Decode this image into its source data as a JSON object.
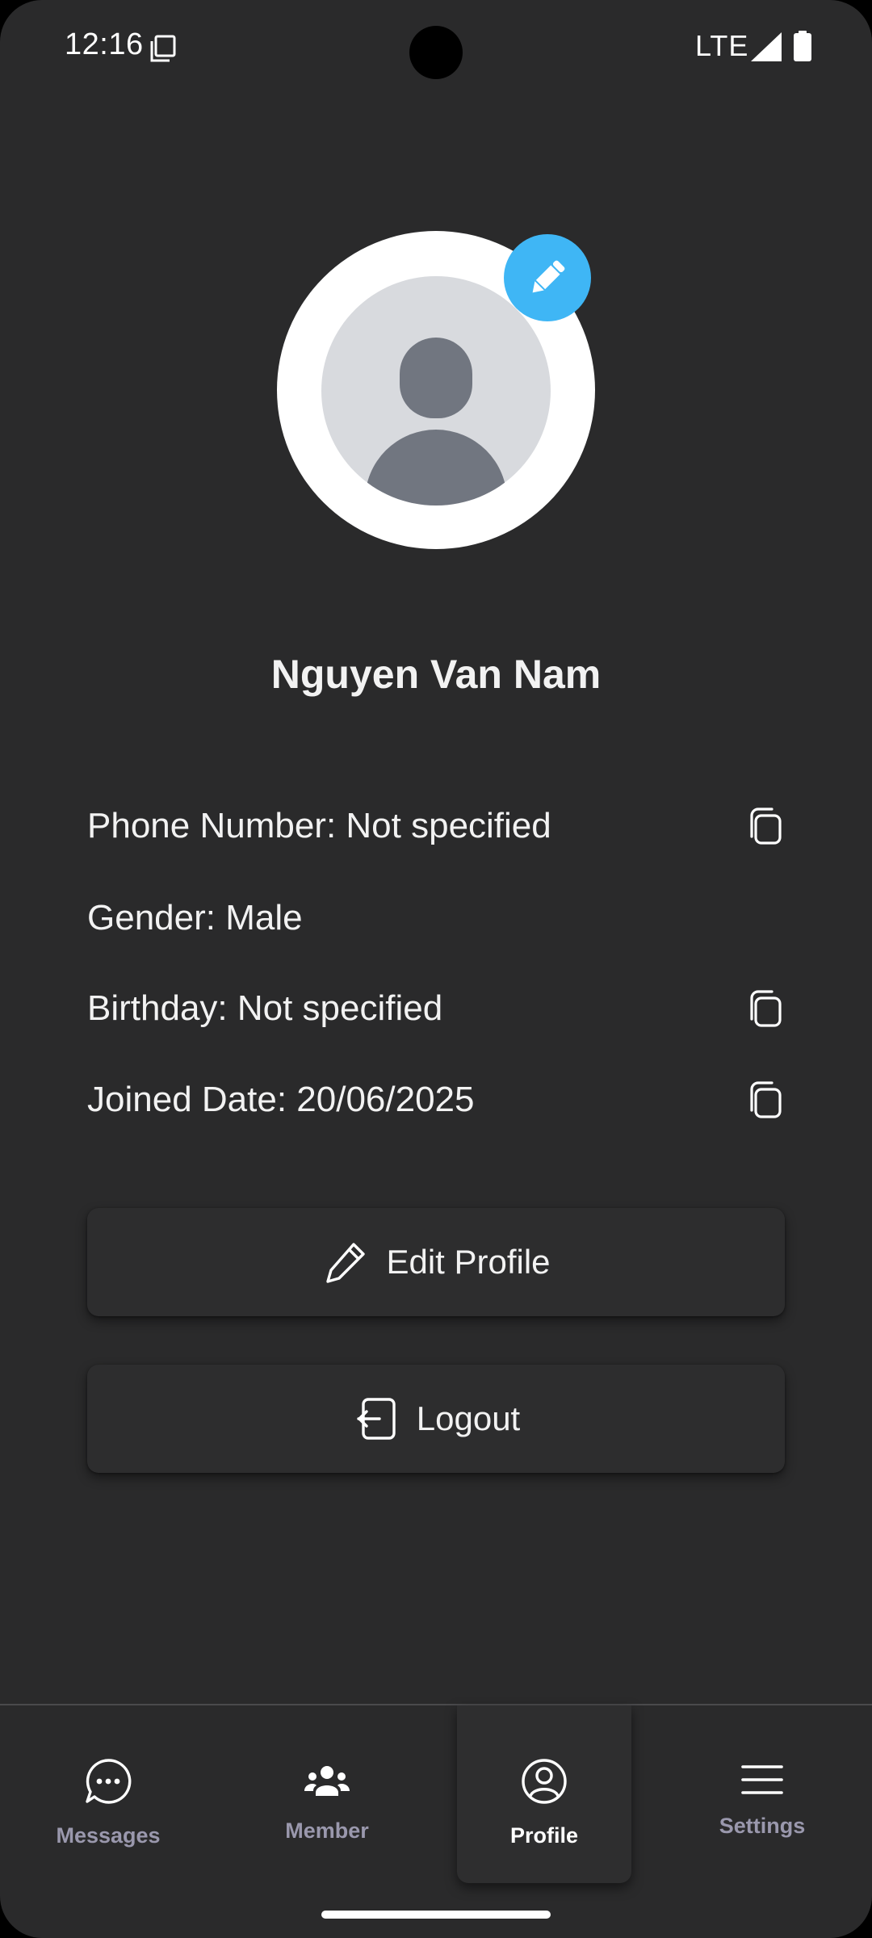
{
  "status_bar": {
    "time": "12:16",
    "network": "LTE",
    "icons": [
      "sim-card-icon",
      "signal-icon",
      "battery-icon"
    ]
  },
  "profile": {
    "name": "Nguyen Van Nam",
    "avatar_icon": "person-placeholder-icon",
    "edit_avatar_icon": "pencil-icon"
  },
  "info": {
    "phone": "Phone Number: Not specified",
    "gender": "Gender: Male",
    "birthday": "Birthday: Not specified",
    "joined": "Joined Date: 20/06/2025"
  },
  "actions": {
    "edit_profile": "Edit Profile",
    "logout": "Logout"
  },
  "nav": {
    "items": [
      {
        "label": "Messages",
        "icon": "chat-bubble-icon"
      },
      {
        "label": "Member",
        "icon": "group-icon"
      },
      {
        "label": "Profile",
        "icon": "account-circle-icon",
        "active": true
      },
      {
        "label": "Settings",
        "icon": "menu-icon"
      }
    ]
  },
  "colors": {
    "background": "#2a2a2b",
    "accent": "#3fb6f5",
    "nav_inactive": "#9a98ad",
    "text": "#f2f2f2"
  }
}
